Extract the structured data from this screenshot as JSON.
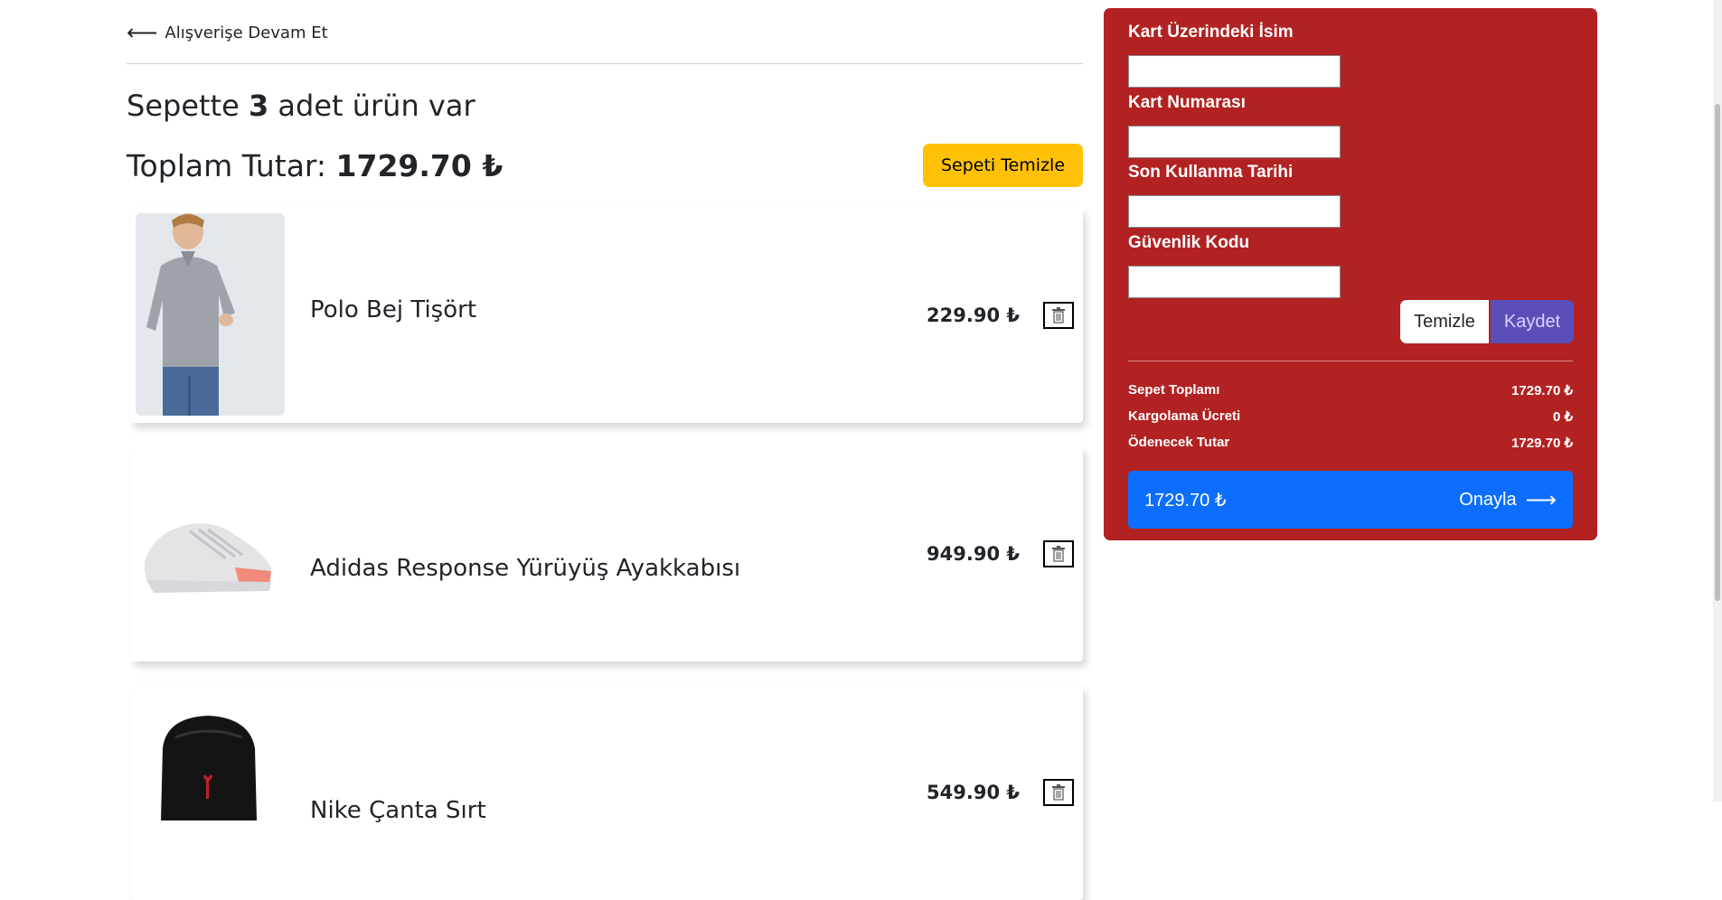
{
  "nav": {
    "back_arrow": "⟵",
    "back_label": "Alışverişe Devam Et"
  },
  "cart": {
    "count_prefix": "Sepette",
    "count_value": "3",
    "count_suffix": "adet ürün var",
    "total_label": "Toplam Tutar:",
    "total_value": "1729.70 ₺",
    "clear_button": "Sepeti Temizle"
  },
  "items": [
    {
      "name": "Polo Bej Tişört",
      "price": "229.90 ₺",
      "image_icon": "polo-shirt-image"
    },
    {
      "name": "Adidas Response Yürüyüş Ayakkabısı",
      "price": "949.90 ₺",
      "image_icon": "sneaker-image"
    },
    {
      "name": "Nike Çanta Sırt",
      "price": "549.90 ₺",
      "image_icon": "backpack-image"
    }
  ],
  "payment": {
    "name_label": "Kart Üzerindeki İsim",
    "number_label": "Kart Numarası",
    "expiry_label": "Son Kullanma Tarihi",
    "cvc_label": "Güvenlik Kodu",
    "name_value": "",
    "number_value": "",
    "expiry_value": "",
    "cvc_value": "",
    "clear_button": "Temizle",
    "save_button": "Kaydet"
  },
  "summary": {
    "subtotal_label": "Sepet Toplamı",
    "subtotal_value": "1729.70 ₺",
    "shipping_label": "Kargolama Ücreti",
    "shipping_value": "0 ₺",
    "payable_label": "Ödenecek Tutar",
    "payable_value": "1729.70 ₺"
  },
  "confirm": {
    "amount": "1729.70 ₺",
    "label": "Onayla",
    "arrow": "⟶"
  },
  "colors": {
    "panel": "#b22222",
    "confirm": "#0d6efd",
    "clear_cart": "#ffc107",
    "save": "#5a4fb8"
  }
}
